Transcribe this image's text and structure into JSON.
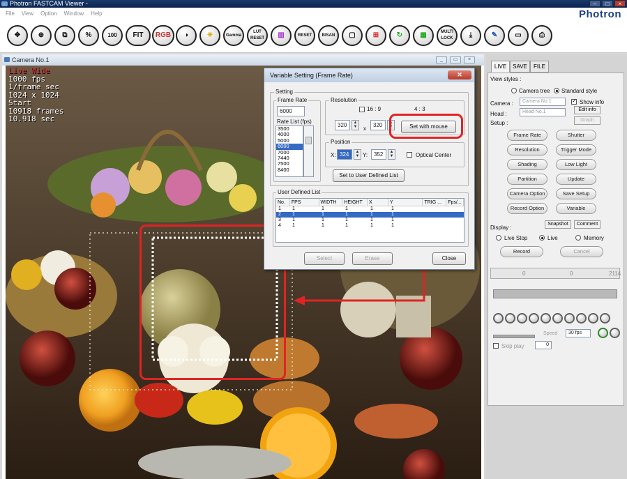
{
  "window": {
    "title": "Photron FASTCAM Viewer -",
    "brand": "Photron"
  },
  "menu": [
    "File",
    "View",
    "Option",
    "Window",
    "Help"
  ],
  "toolbar": {
    "zoom_fit_label": "%",
    "zoom100_label": "100",
    "fit_label": "FIT",
    "rgb_label": "RGB",
    "gamma_label": "Gamma",
    "lut_reset_label": "LUT RESET",
    "bmp_label": "RESET",
    "bisan_label": "BISAN",
    "multi_lock_label": "MULTI LOCK"
  },
  "camera_window": {
    "title": "Camera No.1"
  },
  "overlay": {
    "mode": "Live Wide",
    "fps": "1000 fps",
    "shutter": "1/frame sec",
    "resolution": "1024 x 1024",
    "state": "Start",
    "frames": "10918 frames",
    "seconds": "10.918 sec"
  },
  "dialog": {
    "title": "Variable Setting (Frame Rate)",
    "setting_label": "Setting",
    "frame_rate_label": "Frame Rate",
    "frame_rate_value": "6000",
    "rate_list_label": "Rate List (fps)",
    "rate_list": [
      "3500",
      "4000",
      "5000",
      "6000",
      "7000",
      "7440",
      "7500",
      "8400"
    ],
    "rate_selected": "6000",
    "resolution_label": "Resolution",
    "aspect_16_9": "16 : 9",
    "aspect_4_3": "4 : 3",
    "width_value": "320",
    "height_value": "320",
    "times": "x",
    "set_with_mouse": "Set with mouse",
    "position_label": "Position",
    "x_label": "X:",
    "x_value": "324",
    "y_label": "Y:",
    "y_value": "352",
    "optical_center": "Optical Center",
    "set_user_list": "Set to User Defined List",
    "user_list_label": "User Defined List",
    "columns": [
      "No.",
      "FPS",
      "WIDTH",
      "HEIGHT",
      "X",
      "Y",
      "TRIG ...",
      "Fps/..."
    ],
    "rows": [
      [
        "1",
        "1",
        "1",
        "1",
        "1",
        "1"
      ],
      [
        "2",
        "1",
        "1",
        "1",
        "1",
        "1"
      ],
      [
        "3",
        "1",
        "1",
        "1",
        "1",
        "1"
      ],
      [
        "4",
        "1",
        "1",
        "1",
        "1",
        "1"
      ]
    ],
    "select": "Select",
    "erase": "Erase",
    "close": "Close"
  },
  "panel": {
    "tabs": [
      "LIVE",
      "SAVE",
      "FILE"
    ],
    "view_styles": "View styles :",
    "camera_tree": "Camera tree",
    "standard_style": "Standard style",
    "camera_label": "Camera :",
    "camera_value": "Camera No.1",
    "head_label": "Head :",
    "head_value": "Head No.1",
    "show_info": "Show info",
    "edit_info": "Edit info",
    "graph": "Graph",
    "setup": "Setup :",
    "setup_buttons": [
      "Frame Rate",
      "Shutter",
      "Resolution",
      "Trigger Mode",
      "Shading",
      "Low Light",
      "Partition",
      "Update",
      "Camera Option",
      "Save Setup",
      "Record Option",
      "Variable"
    ],
    "snapshot": "Snapshot",
    "comment": "Comment",
    "display": "Display :",
    "live_stop": "Live Stop",
    "live": "Live",
    "memory": "Memory",
    "record": "Record",
    "cancel": "Cancel",
    "range_start": "0",
    "range_mid": "0",
    "range_end": "2114",
    "speed_label": "Speed",
    "fps_select": "30 fps",
    "skip_label": "Skip play",
    "skip_value": "0"
  },
  "colors": {
    "callout": "#e02424",
    "selection": "#3469c4",
    "brand": "#1e3c8a"
  }
}
